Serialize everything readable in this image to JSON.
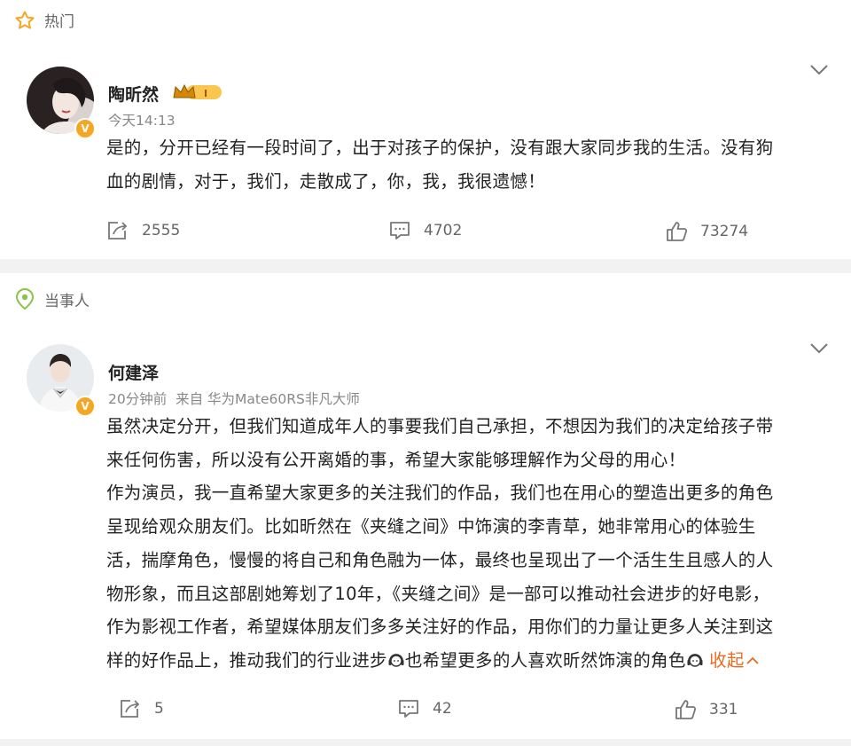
{
  "posts": [
    {
      "tag": "热门",
      "tag_icon": "star-outline-icon",
      "author": "陶昕然",
      "level_badge": "I",
      "time": "今天14:13",
      "lines": [
        "是的，分开已经有一段时间了，出于对孩子的保护，没有跟大家同步我的生活。没有狗",
        "血的剧情，对于，我们，走散成了，你，我，我很遗憾！"
      ],
      "shares": "2555",
      "comments": "4702",
      "likes": "73274"
    },
    {
      "tag": "当事人",
      "tag_icon": "location-pin-icon",
      "author": "何建泽",
      "time": "20分钟前",
      "source_prefix": "来自",
      "source": "华为Mate60RS非凡大师",
      "lines": [
        "虽然决定分开，但我们知道成年人的事要我们自己承担，不想因为我们的决定给孩子带",
        "来任何伤害，所以没有公开离婚的事，希望大家能够理解作为父母的用心！",
        "作为演员，我一直希望大家更多的关注我们的作品，我们也在用心的塑造出更多的角色",
        "呈现给观众朋友们。比如昕然在《夹缝之间》中饰演的李青草，她非常用心的体验生",
        "活，揣摩角色，慢慢的将自己和角色融为一体，最终也呈现出了一个活生生且感人的人",
        "物形象，而且这部剧她筹划了10年，《夹缝之间》是一部可以推动社会进步的好电影，",
        "作为影视工作者，希望媒体朋友们多多关注好的作品，用你们的力量让更多人关注到这"
      ],
      "last_line_a": "样的好作品上，推动我们的行业进步",
      "last_line_b": "也希望更多的人喜欢昕然饰演的角色",
      "emoji_icon": "headphones-face-emoji-icon",
      "collapse": "收起",
      "shares": "5",
      "comments": "42",
      "likes": "331"
    }
  ],
  "colors": {
    "tag_star": "#f5a623",
    "tag_pin": "#8bc34a",
    "verified": "#f5a623",
    "collapse": "#e86b1f",
    "divider": "#f2f2f2"
  }
}
